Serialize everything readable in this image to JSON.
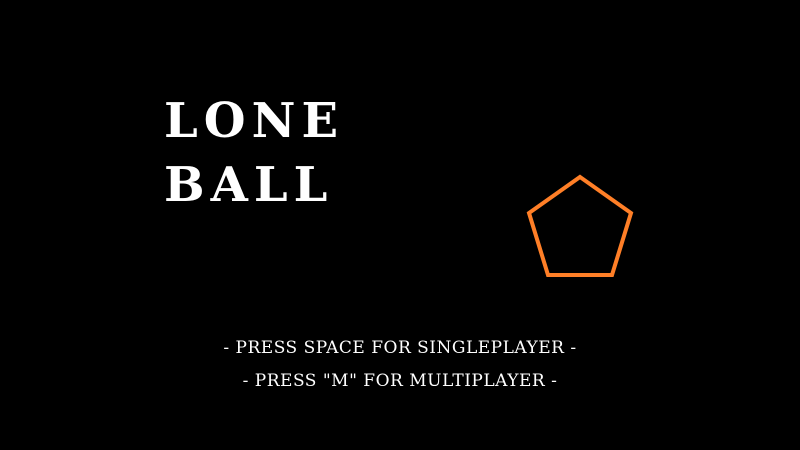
{
  "title": {
    "line1": "LONE",
    "line2": "BALL"
  },
  "menu": {
    "singleplayer": "- PRESS SPACE FOR SINGLEPLAYER -",
    "multiplayer": "- PRESS \"M\" FOR MULTIPLAYER -"
  },
  "colors": {
    "background": "#000000",
    "text": "#ffffff",
    "pentagon": "#ff7f27"
  },
  "icons": {
    "player": "pentagon-icon"
  }
}
